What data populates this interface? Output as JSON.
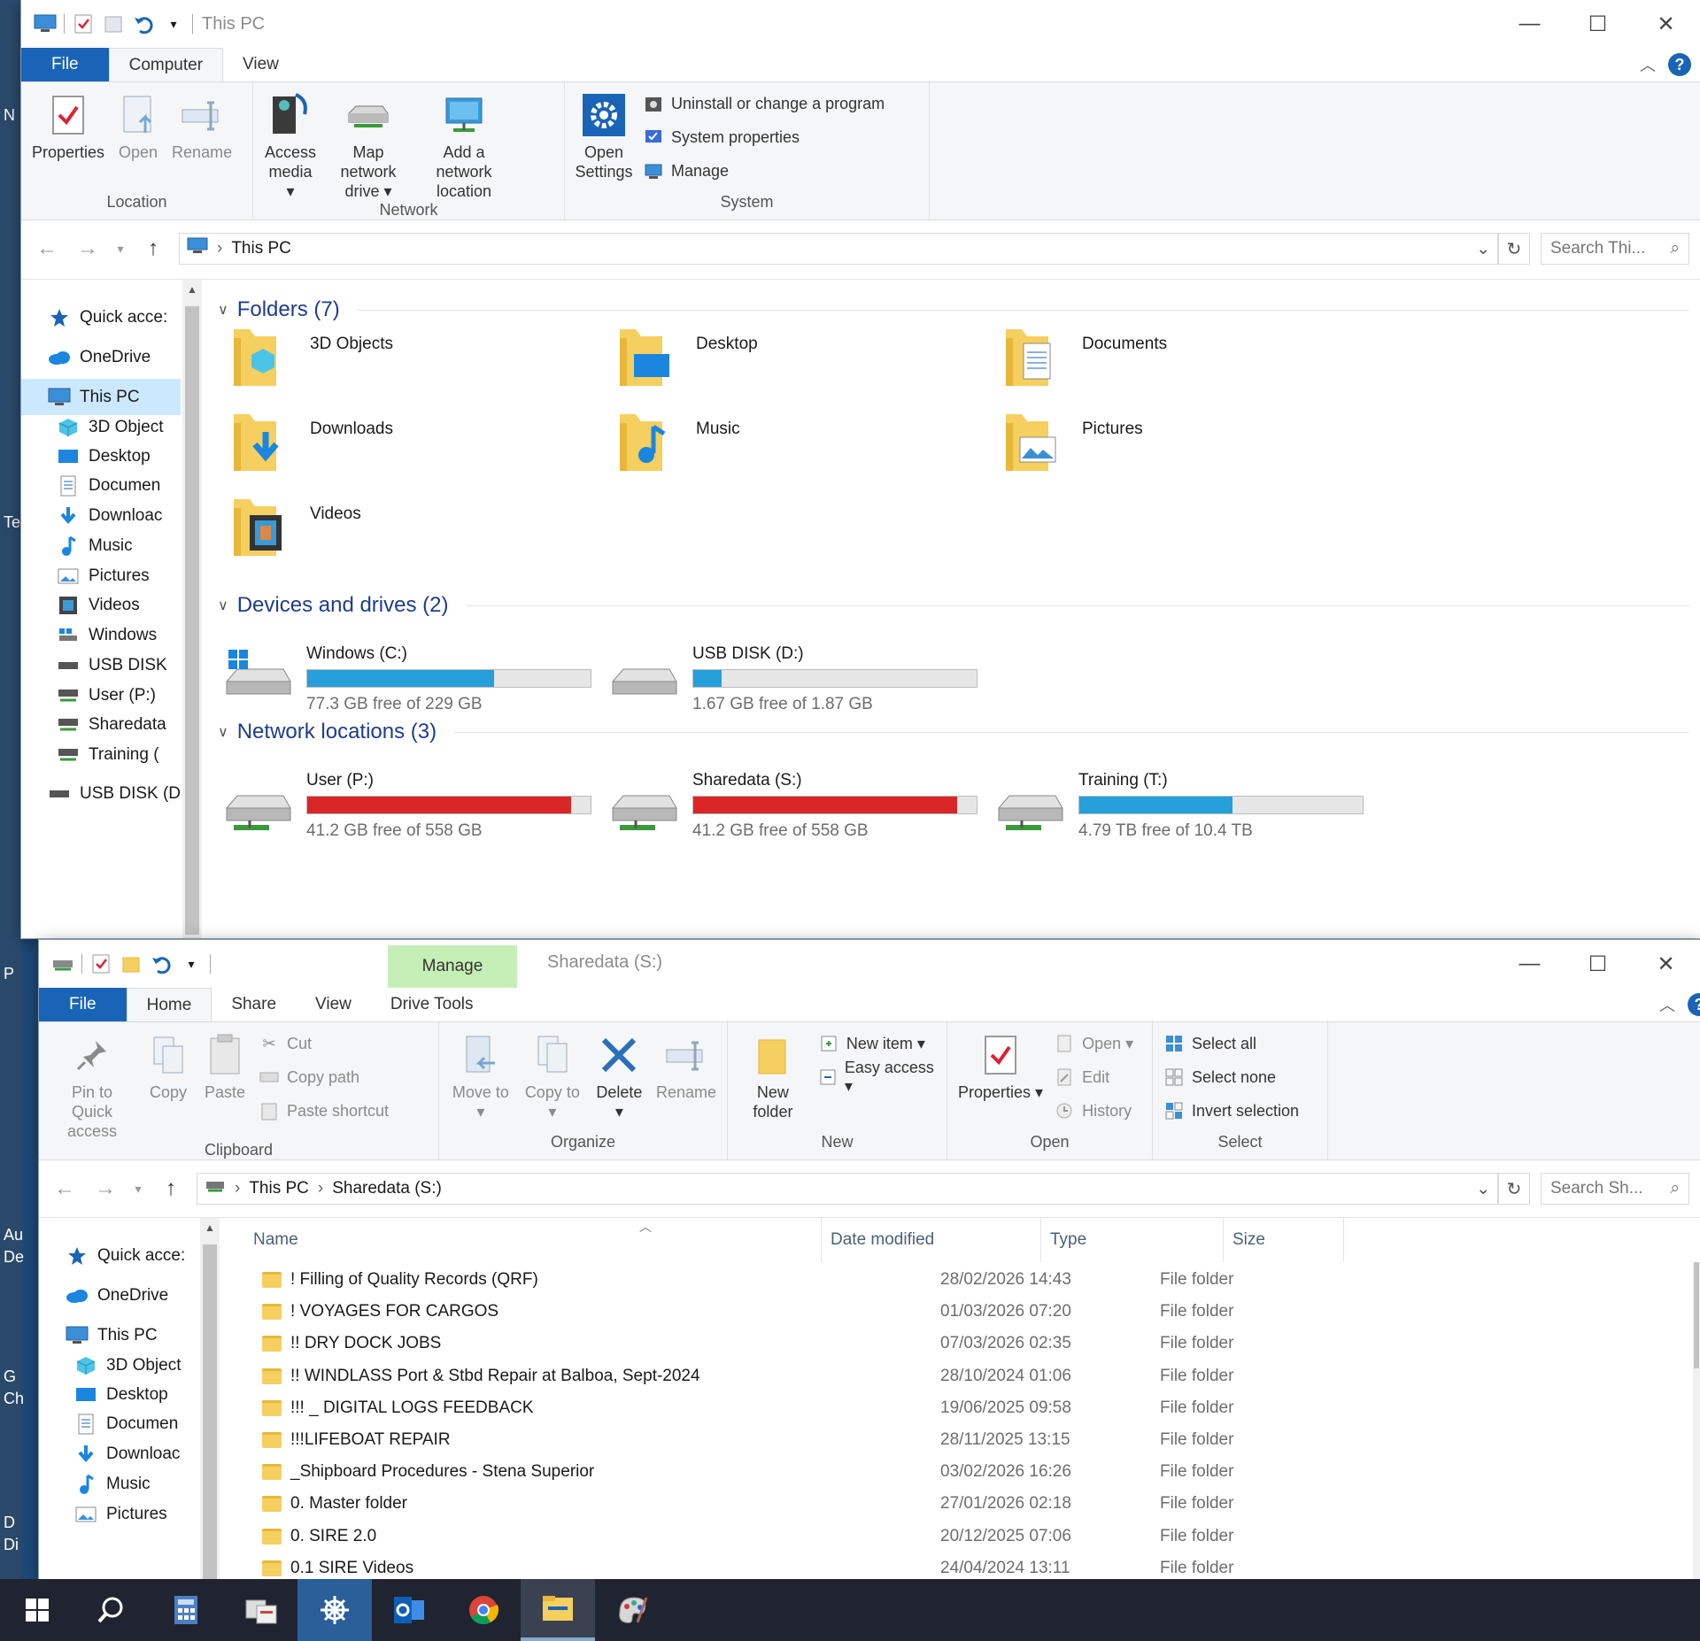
{
  "desktop": {
    "labels": [
      "N",
      "Te",
      "P",
      "Au",
      "De",
      "G",
      "Ch",
      "D",
      "Di"
    ]
  },
  "window1": {
    "title": "This PC",
    "tabs": [
      "File",
      "Computer",
      "View"
    ],
    "ribbon": {
      "location": {
        "label": "Location",
        "properties": "Properties",
        "open": "Open",
        "rename": "Rename"
      },
      "network": {
        "label": "Network",
        "access_media": "Access media ▾",
        "map_drive": "Map network drive ▾",
        "add_location": "Add a network location"
      },
      "system": {
        "label": "System",
        "open_settings": "Open Settings",
        "uninstall": "Uninstall or change a program",
        "system_properties": "System properties",
        "manage": "Manage"
      }
    },
    "address": {
      "path": "This PC",
      "search_placeholder": "Search Thi..."
    },
    "sidebar": [
      "Quick acce:",
      "OneDrive",
      "This PC",
      "3D Object",
      "Desktop",
      "Documen",
      "Downloac",
      "Music",
      "Pictures",
      "Videos",
      "Windows",
      "USB DISK",
      "User (P:)",
      "Sharedata",
      "Training (",
      "USB DISK (D"
    ],
    "sections": {
      "folders": "Folders (7)",
      "devices": "Devices and drives (2)",
      "network": "Network locations (3)"
    },
    "folders": [
      "3D Objects",
      "Desktop",
      "Documents",
      "Downloads",
      "Music",
      "Pictures",
      "Videos"
    ],
    "drives": [
      {
        "name": "Windows (C:)",
        "free": "77.3 GB free of 229 GB",
        "used": 0.66,
        "color": "#26a0da"
      },
      {
        "name": "USB DISK (D:)",
        "free": "1.67 GB free of 1.87 GB",
        "used": 0.1,
        "color": "#26a0da"
      }
    ],
    "netlocs": [
      {
        "name": "User (P:)",
        "free": "41.2 GB free of 558 GB",
        "used": 0.93,
        "color": "#da2626"
      },
      {
        "name": "Sharedata (S:)",
        "free": "41.2 GB free of 558 GB",
        "used": 0.93,
        "color": "#da2626"
      },
      {
        "name": "Training (T:)",
        "free": "4.79 TB free of 10.4 TB",
        "used": 0.54,
        "color": "#26a0da"
      }
    ]
  },
  "window2": {
    "title": "Sharedata (S:)",
    "context_tab": "Manage",
    "tabs": [
      "File",
      "Home",
      "Share",
      "View",
      "Drive Tools"
    ],
    "ribbon": {
      "clipboard": {
        "label": "Clipboard",
        "pin": "Pin to Quick access",
        "copy": "Copy",
        "paste": "Paste",
        "cut": "Cut",
        "copy_path": "Copy path",
        "paste_shortcut": "Paste shortcut"
      },
      "organize": {
        "label": "Organize",
        "move_to": "Move to ▾",
        "copy_to": "Copy to ▾",
        "delete": "Delete ▾",
        "rename": "Rename"
      },
      "new": {
        "label": "New",
        "new_folder": "New folder",
        "new_item": "New item ▾",
        "easy_access": "Easy access ▾"
      },
      "open": {
        "label": "Open",
        "properties": "Properties ▾",
        "open": "Open ▾",
        "edit": "Edit",
        "history": "History"
      },
      "select": {
        "label": "Select",
        "select_all": "Select all",
        "select_none": "Select none",
        "invert": "Invert selection"
      }
    },
    "address": {
      "crumbs": [
        "This PC",
        "Sharedata (S:)"
      ],
      "search_placeholder": "Search Sh..."
    },
    "sidebar": [
      "Quick acce:",
      "OneDrive",
      "This PC",
      "3D Object",
      "Desktop",
      "Documen",
      "Downloac",
      "Music",
      "Pictures"
    ],
    "columns": [
      "Name",
      "Date modified",
      "Type",
      "Size"
    ],
    "rows": [
      {
        "name": "! Filling of Quality Records (QRF)",
        "date": "28/02/2026 14:43",
        "type": "File folder"
      },
      {
        "name": "! VOYAGES FOR CARGOS",
        "date": "01/03/2026 07:20",
        "type": "File folder"
      },
      {
        "name": "!! DRY DOCK JOBS",
        "date": "07/03/2026 02:35",
        "type": "File folder"
      },
      {
        "name": "!! WINDLASS Port & Stbd Repair at Balboa, Sept-2024",
        "date": "28/10/2024 01:06",
        "type": "File folder"
      },
      {
        "name": "!!! _ DIGITAL LOGS FEEDBACK",
        "date": "19/06/2025 09:58",
        "type": "File folder"
      },
      {
        "name": "!!!LIFEBOAT REPAIR",
        "date": "28/11/2025 13:15",
        "type": "File folder"
      },
      {
        "name": "_Shipboard Procedures - Stena Superior",
        "date": "03/02/2026 16:26",
        "type": "File folder"
      },
      {
        "name": "0. Master folder",
        "date": "27/01/2026 02:18",
        "type": "File folder"
      },
      {
        "name": "0. SIRE 2.0",
        "date": "20/12/2025 07:06",
        "type": "File folder"
      },
      {
        "name": "0.1 SIRE Videos",
        "date": "24/04/2024 13:11",
        "type": "File folder"
      }
    ]
  },
  "taskbar": [
    "start-icon",
    "search-icon",
    "calculator-icon",
    "file-manager-icon",
    "ship-helm-icon",
    "outlook-icon",
    "chrome-icon",
    "file-explorer-icon",
    "paint-icon"
  ]
}
